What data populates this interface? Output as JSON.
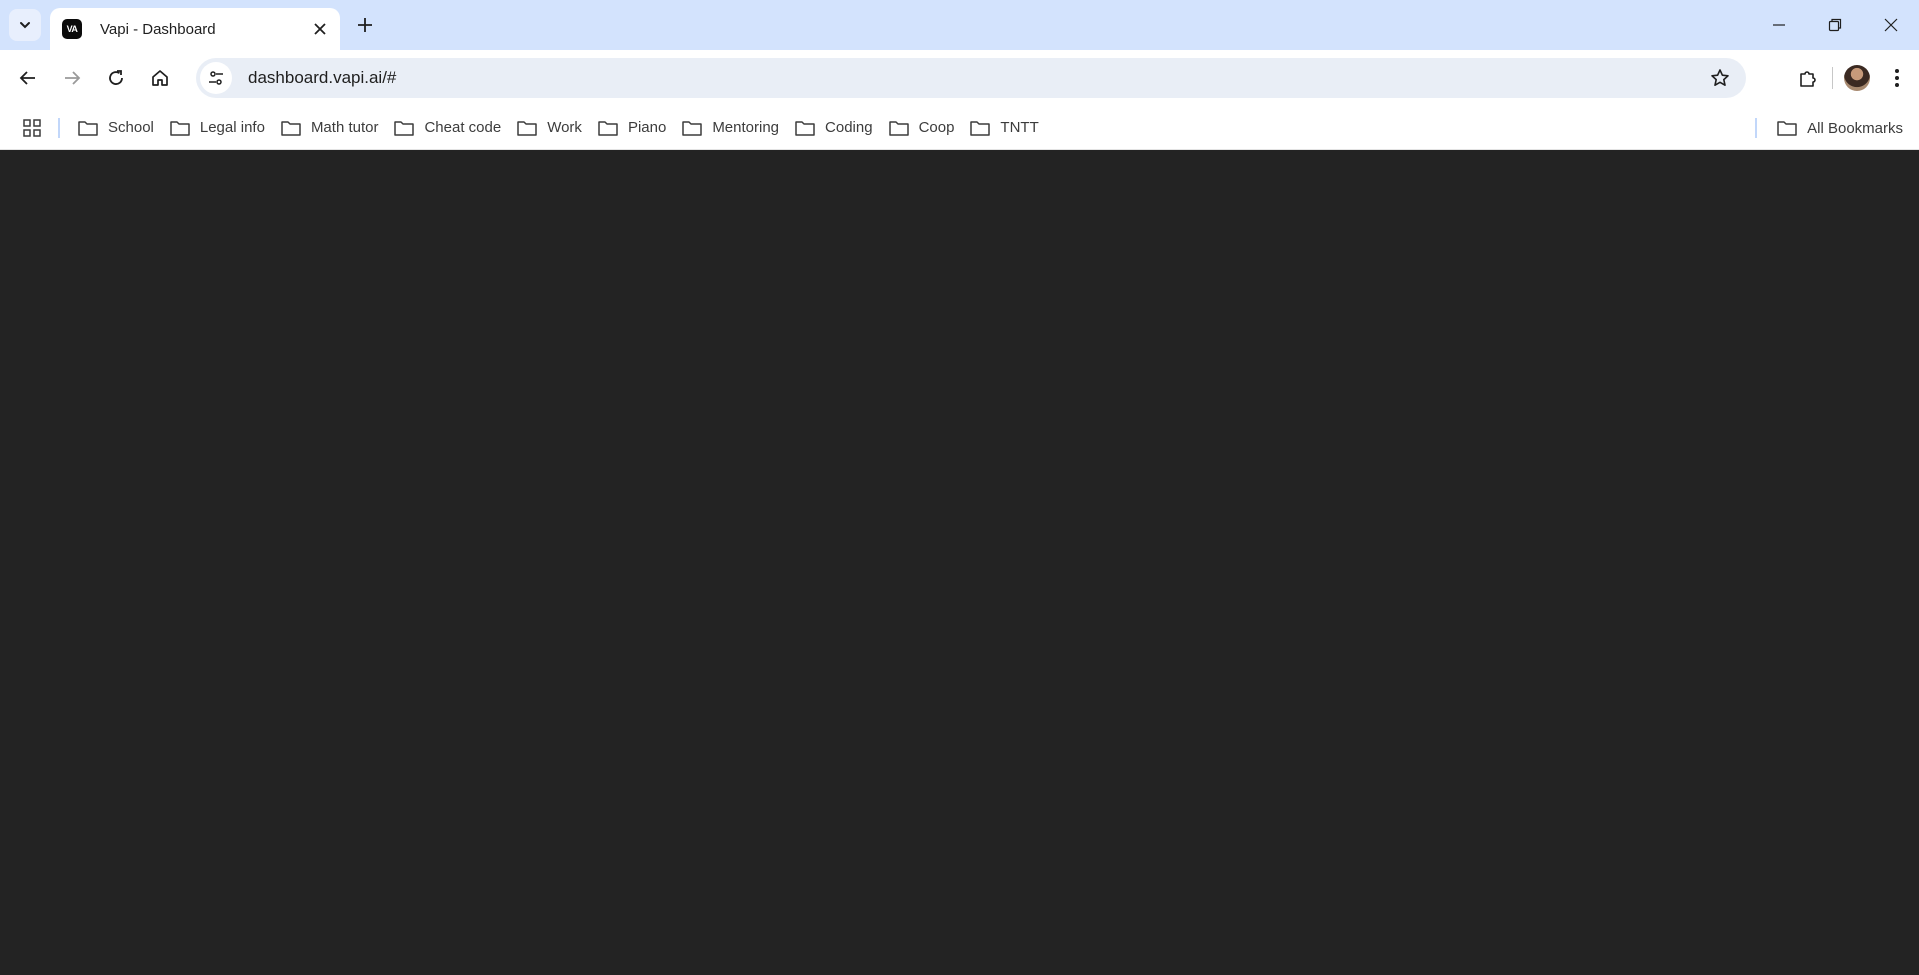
{
  "tab": {
    "title": "Vapi - Dashboard",
    "favicon_text": "VA"
  },
  "address_bar": {
    "url": "dashboard.vapi.ai/#"
  },
  "bookmarks": {
    "items": [
      {
        "label": "School"
      },
      {
        "label": "Legal info"
      },
      {
        "label": "Math tutor"
      },
      {
        "label": "Cheat code"
      },
      {
        "label": "Work"
      },
      {
        "label": "Piano"
      },
      {
        "label": "Mentoring"
      },
      {
        "label": "Coding"
      },
      {
        "label": "Coop"
      },
      {
        "label": "TNTT"
      }
    ],
    "all_label": "All Bookmarks"
  },
  "colors": {
    "tabstrip_bg": "#d3e3fd",
    "content_bg": "#232323",
    "omnibox_bg": "#e9eef6"
  }
}
